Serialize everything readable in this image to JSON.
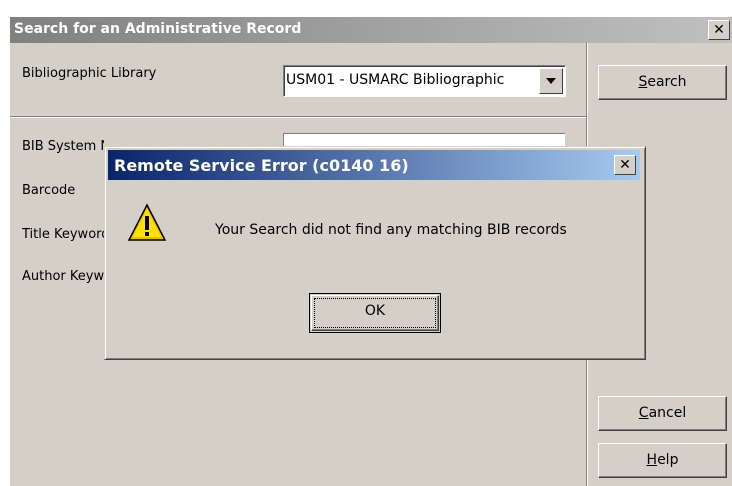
{
  "window": {
    "title": "Search for an Administrative Record",
    "close_label": "✕"
  },
  "form": {
    "library_label": "Bibliographic Library",
    "library_value": "USM01 - USMARC Bibliographic",
    "bib_system_number_label": "BIB System Number",
    "barcode_label": "Barcode",
    "title_keyword_label": "Title Keyword",
    "author_keyword_label": "Author Keyword"
  },
  "buttons": {
    "search": "Search",
    "search_mnemonic": "S",
    "cancel": "Cancel",
    "cancel_mnemonic": "C",
    "help": "Help",
    "help_mnemonic": "H"
  },
  "dialog": {
    "title": "Remote Service Error (c0140 16)",
    "close_label": "✕",
    "icon": "warning-icon",
    "message": "Your Search did not find any matching BIB records",
    "ok_label": "OK"
  }
}
